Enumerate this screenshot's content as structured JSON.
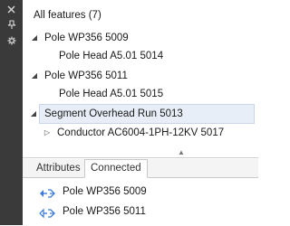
{
  "sidebar": {
    "icons": [
      "close-icon",
      "pin-icon",
      "settings-icon"
    ]
  },
  "header": {
    "title": "All features (7)"
  },
  "tree": [
    {
      "label": "Pole WP356 5009",
      "level": 0,
      "expanded": true,
      "selected": false
    },
    {
      "label": "Pole Head A5.01 5014",
      "level": 1,
      "expanded": null,
      "selected": false
    },
    {
      "label": "Pole WP356 5011",
      "level": 0,
      "expanded": true,
      "selected": false
    },
    {
      "label": "Pole Head A5.01 5015",
      "level": 1,
      "expanded": null,
      "selected": false
    },
    {
      "label": "Segment Overhead Run 5013",
      "level": 0,
      "expanded": true,
      "selected": true
    },
    {
      "label": "Conductor AC6004-1PH-12KV 5017",
      "level": 1,
      "expanded": false,
      "selected": false
    }
  ],
  "tabs": [
    {
      "label": "Attributes",
      "active": false
    },
    {
      "label": "Connected",
      "active": true
    }
  ],
  "connected": [
    {
      "label": "Pole WP356 5009",
      "icon": "connection-icon"
    },
    {
      "label": "Pole WP356 5011",
      "icon": "connection-icon"
    }
  ],
  "colors": {
    "sidebar": "#3a3a3a",
    "selected_row": "#e7eef7",
    "icon_blue": "#3a7bd5"
  }
}
